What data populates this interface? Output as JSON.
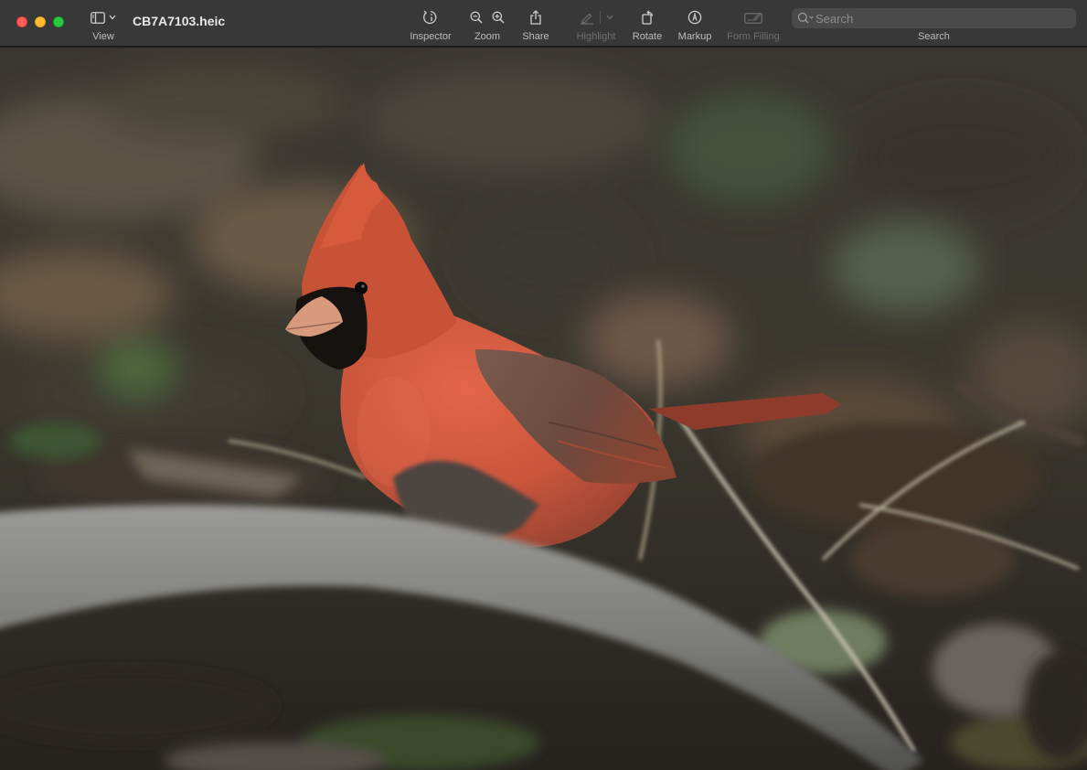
{
  "window": {
    "title": "CB7A7103.heic"
  },
  "toolbar": {
    "view_label": "View",
    "inspector_label": "Inspector",
    "zoom_label": "Zoom",
    "share_label": "Share",
    "highlight_label": "Highlight",
    "rotate_label": "Rotate",
    "markup_label": "Markup",
    "form_filling_label": "Form Filling",
    "search_label": "Search",
    "search_placeholder": "Search",
    "search_value": ""
  },
  "icons": {
    "view": "sidebar-icon",
    "inspector": "info-icon",
    "zoom_out": "zoom-out-icon",
    "zoom_in": "zoom-in-icon",
    "share": "share-icon",
    "highlight": "highlighter-icon",
    "rotate": "rotate-icon",
    "markup": "markup-pen-icon",
    "form_filling": "form-filling-icon",
    "search": "magnifier-icon"
  },
  "colors": {
    "toolbar_bg": "#383838",
    "close": "#ff5f57",
    "minimize": "#febc2e",
    "maximize": "#28c840"
  }
}
